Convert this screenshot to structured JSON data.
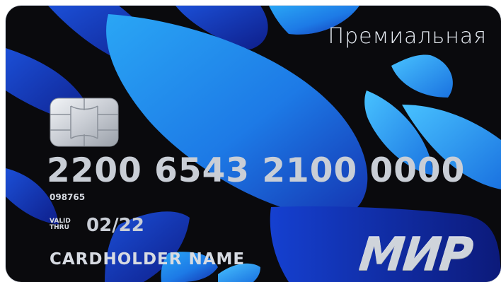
{
  "card": {
    "tier": "Премиальная",
    "number": "2200 6543 2100 0000",
    "bin_code": "098765",
    "valid_label_line1": "VALID",
    "valid_label_line2": "THRU",
    "expiry": "02/22",
    "holder": "CARDHOLDER NAME",
    "brand": "МИР",
    "colors": {
      "background": "#0a0a0d",
      "accent_blue": "#1e8ff0",
      "deep_blue": "#1633b8",
      "text_silver": "#c9ced6"
    }
  }
}
